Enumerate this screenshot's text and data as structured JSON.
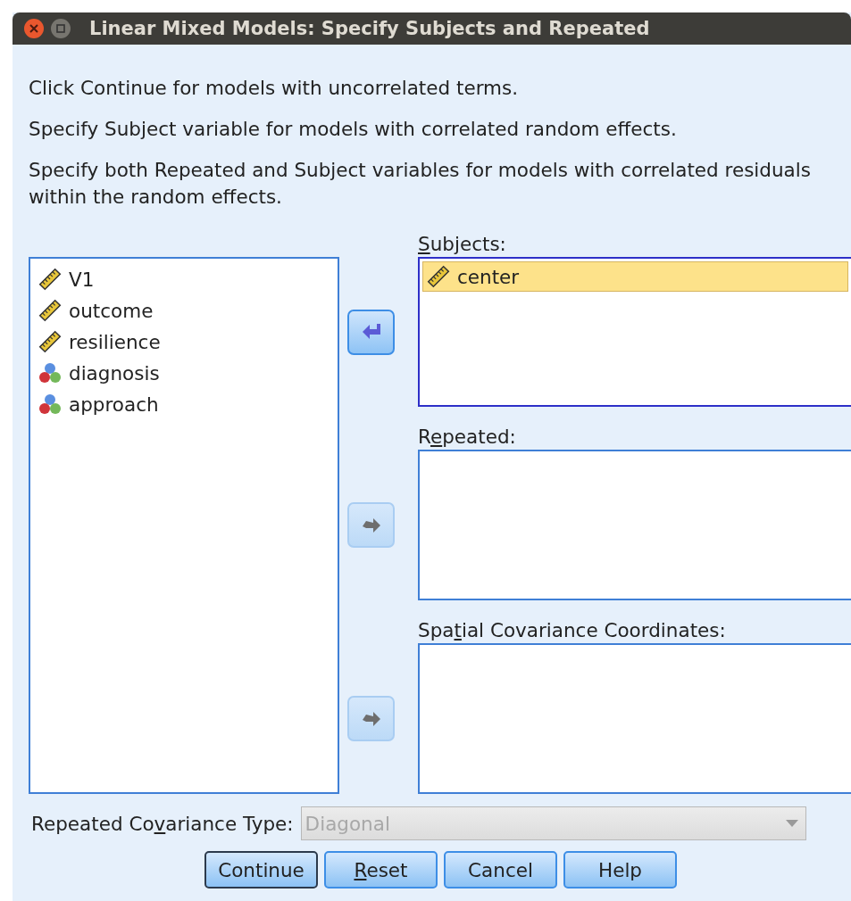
{
  "window": {
    "title": "Linear Mixed Models: Specify Subjects and Repeated"
  },
  "instructions": [
    "Click Continue for models with uncorrelated terms.",
    "Specify Subject variable for models with correlated random effects.",
    "Specify both Repeated and Subject variables for models with correlated residuals within the random effects."
  ],
  "variables": [
    {
      "name": "V1",
      "kind": "scale"
    },
    {
      "name": "outcome",
      "kind": "scale"
    },
    {
      "name": "resilience",
      "kind": "scale"
    },
    {
      "name": "diagnosis",
      "kind": "nominal"
    },
    {
      "name": "approach",
      "kind": "nominal"
    }
  ],
  "targets": [
    {
      "label": {
        "key": "S",
        "after": "ubjects:"
      },
      "arrow": {
        "kind": "left",
        "disabled": false
      },
      "items": [
        {
          "name": "center",
          "kind": "scale",
          "selected": true
        }
      ]
    },
    {
      "label": {
        "before": "R",
        "key": "e",
        "after": "peated:"
      },
      "arrow": {
        "kind": "right",
        "disabled": true
      }
    },
    {
      "label": {
        "before": "Spa",
        "key": "t",
        "after": "ial Covariance Coordinates:"
      },
      "arrow": {
        "kind": "right",
        "disabled": true
      }
    }
  ],
  "covariance_type": {
    "label": {
      "before": "Repeated Co",
      "key": "v",
      "after": "ariance Type:"
    },
    "value": "Diagonal",
    "disabled": true
  },
  "buttons": [
    {
      "label": {
        "before": "Continue"
      },
      "default": true
    },
    {
      "label": {
        "key": "R",
        "after": "eset"
      },
      "default": false
    },
    {
      "label": {
        "before": "Cancel"
      },
      "default": false
    },
    {
      "label": {
        "before": "Help"
      },
      "default": false
    }
  ]
}
